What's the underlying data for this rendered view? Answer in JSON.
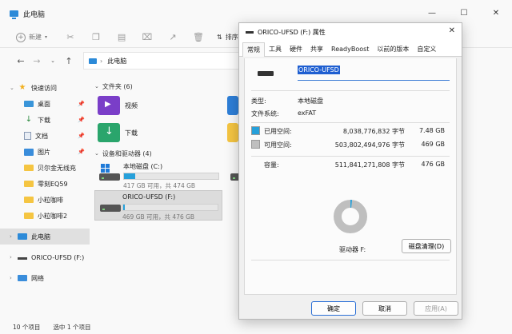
{
  "explorer": {
    "title": "此电脑",
    "toolbar": {
      "new_label": "新建",
      "sort_label": "排序"
    },
    "address": {
      "path": "此电脑"
    },
    "sidebar": {
      "quick_access": "快速访问",
      "pinned": [
        "桌面",
        "下载",
        "文档",
        "图片"
      ],
      "folders": [
        "贝尔金无线充",
        "零刻EQ59",
        "小粒咖啡",
        "小粒咖啡2"
      ],
      "this_pc": "此电脑",
      "drive": "ORICO-UFSD (F:)",
      "network": "网络"
    },
    "sections": {
      "folders_header": "文件夹 (6)",
      "devices_header": "设备和驱动器 (4)"
    },
    "folders": {
      "video": "视频",
      "download": "下载"
    },
    "drives": [
      {
        "name": "本地磁盘 (C:)",
        "sub": "417 GB 可用，共 474 GB",
        "used_fraction": 0.12
      },
      {
        "name": "ORICO-UFSD (F:)",
        "sub": "469 GB 可用，共 476 GB",
        "used_fraction": 0.015
      }
    ],
    "status": {
      "count": "10 个项目",
      "selected": "选中 1 个项目"
    }
  },
  "dialog": {
    "title": "ORICO-UFSD (F:) 属性",
    "tabs": [
      "常规",
      "工具",
      "硬件",
      "共享",
      "ReadyBoost",
      "以前的版本",
      "自定义"
    ],
    "volume_name": "ORICO-UFSD",
    "type_label": "类型:",
    "type_value": "本地磁盘",
    "fs_label": "文件系统:",
    "fs_value": "exFAT",
    "used_label": "已用空间:",
    "used_bytes": "8,038,776,832 字节",
    "used_human": "7.48 GB",
    "free_label": "可用空间:",
    "free_bytes": "503,802,494,976 字节",
    "free_human": "469 GB",
    "capacity_label": "容量:",
    "capacity_bytes": "511,841,271,808 字节",
    "capacity_human": "476 GB",
    "drive_label": "驱动器 F:",
    "cleanup_label": "磁盘清理(D)",
    "used_fraction": 0.0157,
    "colors": {
      "used": "#26a0da",
      "free": "#bfbfbf"
    },
    "buttons": {
      "ok": "确定",
      "cancel": "取消",
      "apply": "应用(A)"
    }
  }
}
